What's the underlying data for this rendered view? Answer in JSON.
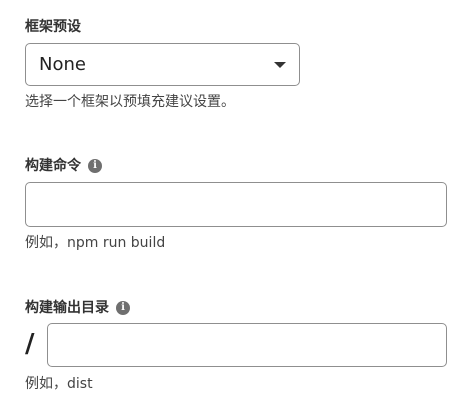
{
  "framework": {
    "label": "框架预设",
    "selected": "None",
    "help": "选择一个框架以预填充建议设置。"
  },
  "build_command": {
    "label": "构建命令",
    "info_icon": "info-icon",
    "value": "",
    "help": "例如，npm run build"
  },
  "output_dir": {
    "label": "构建输出目录",
    "info_icon": "info-icon",
    "prefix": "/",
    "value": "",
    "help": "例如，dist"
  }
}
